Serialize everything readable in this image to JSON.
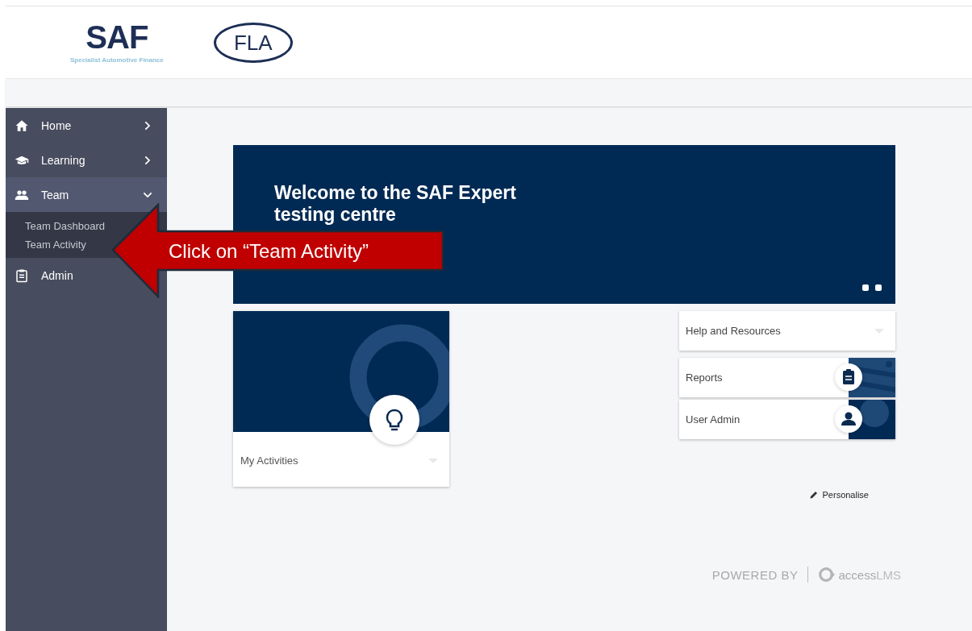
{
  "header": {
    "logos": [
      {
        "kind": "saf",
        "text": "SAF",
        "tagline": "Specialist Automotive Finance"
      },
      {
        "kind": "fla",
        "text": "FLA"
      }
    ]
  },
  "sidebar": {
    "items": [
      {
        "label": "Home",
        "selected": false,
        "expanded": false
      },
      {
        "label": "Learning",
        "selected": false,
        "expanded": false
      },
      {
        "label": "Team",
        "selected": true,
        "expanded": true,
        "children": [
          {
            "label": "Team Dashboard"
          },
          {
            "label": "Team Activity"
          }
        ]
      },
      {
        "label": "Admin"
      }
    ]
  },
  "banner": {
    "title": "Welcome to the SAF Expert testing centre"
  },
  "tiles": [
    {
      "label": "My Activities"
    }
  ],
  "links": [
    {
      "kind": "dropdown",
      "label": "Help and Resources"
    },
    {
      "kind": "reports",
      "label": "Reports"
    },
    {
      "kind": "user",
      "label": "User Admin"
    }
  ],
  "personalise": "Personalise",
  "footer": {
    "powered_by": "POWERED BY",
    "brand": "access",
    "brand_suffix": "LMS"
  },
  "callout": {
    "text": "Click on “Team Activity”"
  }
}
